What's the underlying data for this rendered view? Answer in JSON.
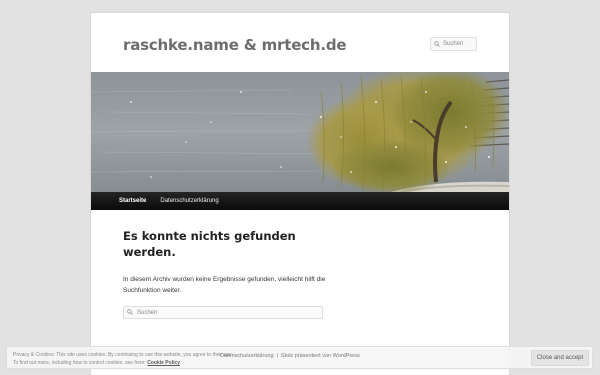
{
  "site": {
    "title": "raschke.name & mrtech.de",
    "header_search_placeholder": "Suchen"
  },
  "banner": {
    "alt": "Weeping willow by a lake with snowfall"
  },
  "nav": {
    "items": [
      {
        "label": "Startseite",
        "current": true
      },
      {
        "label": "Datenschutzerklärung",
        "current": false
      }
    ]
  },
  "content": {
    "title": "Es konnte nichts gefunden werden.",
    "text": "In diesem Archiv wurden keine Ergebnisse gefunden, vielleicht hilft die Suchfunktion weiter.",
    "search_placeholder": "Suchen"
  },
  "cookie": {
    "line1": "Privacy & Cookies: This site uses cookies. By continuing to use this website, you agree to their use.",
    "line2": "To find out more, including how to control cookies, see here:",
    "link": "Cookie Policy",
    "button": "Close and accept"
  },
  "footer": {
    "link1": "Datenschutzerklärung",
    "separator": "|",
    "link2": "Stolz präsentiert von WordPress"
  }
}
